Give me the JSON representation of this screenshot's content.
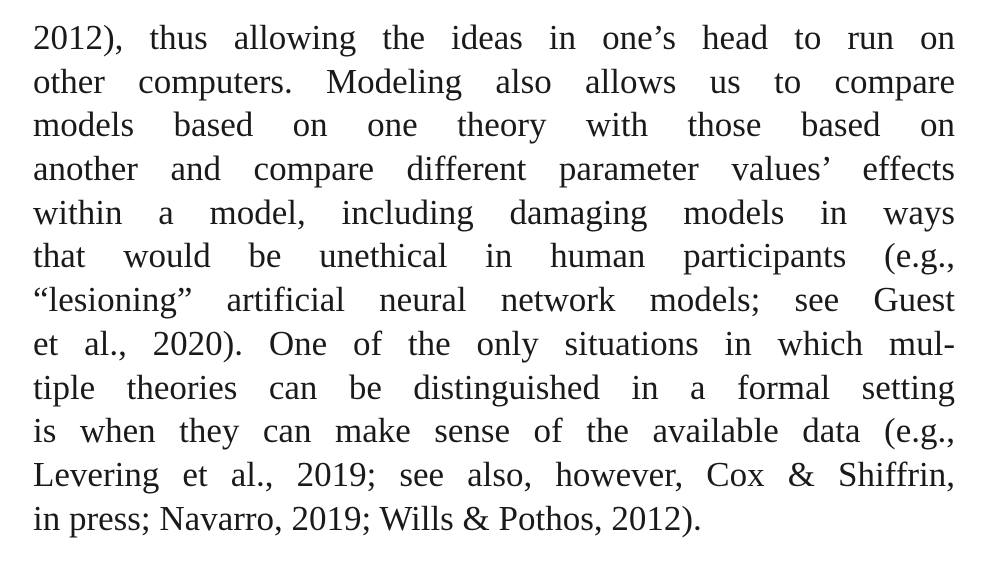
{
  "paragraph": {
    "lines": [
      "2012), thus allowing the ideas in one’s head to run on",
      "other computers. Modeling also allows us to compare",
      "models based on one theory with those based on",
      "another and compare different parameter values’ effects",
      "within a model, including damaging models in ways",
      "that would be unethical in human participants (e.g.,",
      "“lesioning” artificial neural network models; see Guest",
      "et al., 2020). One of the only situations in which mul-",
      "tiple theories can be distinguished in a formal setting",
      "is when they can make sense of the available data (e.g.,",
      "Levering et al., 2019; see also, however, Cox & Shiffrin,",
      "in press; Navarro, 2019; Wills & Pothos, 2012)."
    ]
  }
}
